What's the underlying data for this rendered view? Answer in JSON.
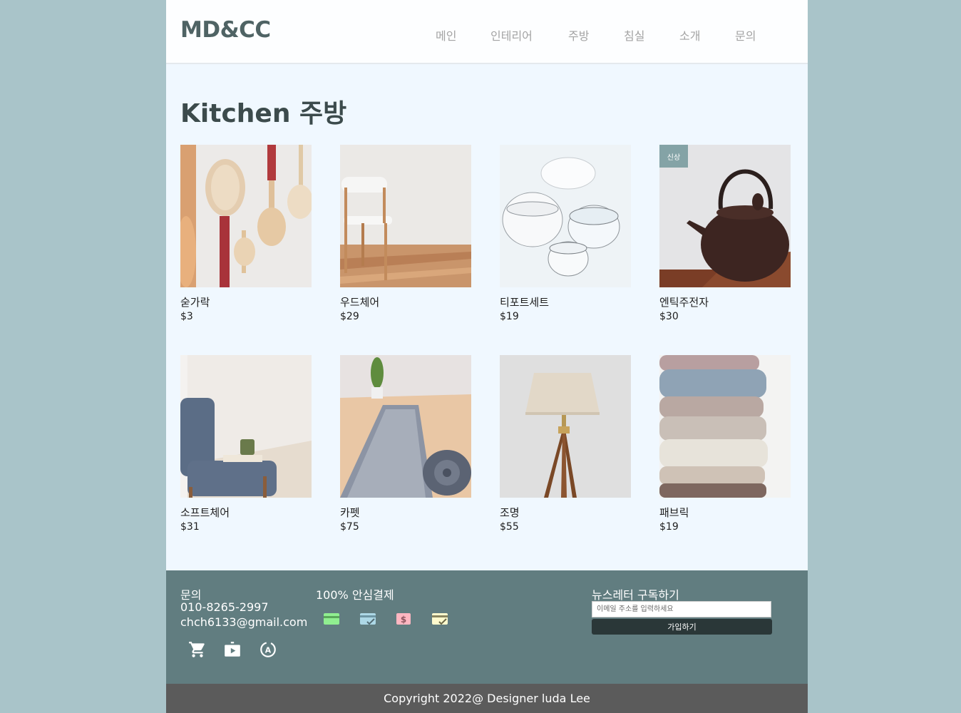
{
  "header": {
    "logo": "MD&CC",
    "nav": [
      {
        "label": "메인"
      },
      {
        "label": "인테리어"
      },
      {
        "label": "주방"
      },
      {
        "label": "침실"
      },
      {
        "label": "소개"
      },
      {
        "label": "문의"
      }
    ]
  },
  "main": {
    "title": "Kitchen 주방",
    "products": [
      {
        "name": "숟가락",
        "price": "$3",
        "image": "wooden-spoons-photo"
      },
      {
        "name": "우드체어",
        "price": "$29",
        "image": "wood-chair-photo"
      },
      {
        "name": "티포트세트",
        "price": "$19",
        "image": "teapot-set-photo"
      },
      {
        "name": "엔틱주전자",
        "price": "$30",
        "image": "antique-kettle-photo",
        "badge": "신상"
      },
      {
        "name": "소프트체어",
        "price": "$31",
        "image": "soft-chair-photo"
      },
      {
        "name": "카펫",
        "price": "$75",
        "image": "carpet-photo"
      },
      {
        "name": "조명",
        "price": "$55",
        "image": "floor-lamp-photo"
      },
      {
        "name": "패브릭",
        "price": "$19",
        "image": "knit-fabric-photo"
      }
    ]
  },
  "footer": {
    "contact": {
      "label": "문의",
      "phone": "010-8265-2997",
      "email": "chch6133@gmail.com",
      "icons": [
        "cart-icon",
        "video-shop-icon",
        "translate-icon"
      ]
    },
    "payment": {
      "label": "100% 안심결제",
      "icons": [
        {
          "name": "credit-card-icon",
          "color": "#90ee90"
        },
        {
          "name": "card-check-icon",
          "color": "#add8e6"
        },
        {
          "name": "dollar-icon",
          "color": "#ffb6c1"
        },
        {
          "name": "card-verified-icon",
          "color": "#fffacd"
        }
      ]
    },
    "newsletter": {
      "label": "뉴스레터 구독하기",
      "placeholder": "이메일 주소를 입력하세요",
      "button": "가입하기"
    },
    "copyright": "Copyright 2022@ Designer luda Lee"
  },
  "colors": {
    "background": "#a9c4c9",
    "page": "#f0f8ff",
    "footer": "#617d80",
    "copyright_bar": "#5b5b5b",
    "badge": "#84a3a6",
    "logo": "#4f6364"
  }
}
